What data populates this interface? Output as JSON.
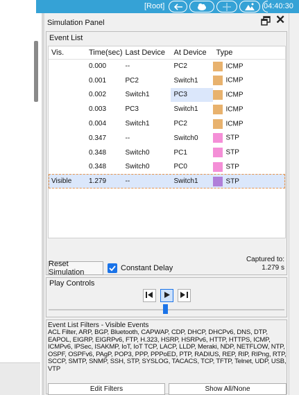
{
  "topbar": {
    "root_label": "[Root]",
    "time": "04:40:30"
  },
  "panel": {
    "title": "Simulation Panel",
    "event_list": {
      "title": "Event List",
      "columns": [
        "Vis.",
        "Time(sec)",
        "Last Device",
        "At Device",
        "Type"
      ],
      "rows": [
        {
          "vis": "",
          "time": "0.000",
          "last": "--",
          "at": "PC2",
          "type": "ICMP",
          "color": "#e8b26e"
        },
        {
          "vis": "",
          "time": "0.001",
          "last": "PC2",
          "at": "Switch1",
          "type": "ICMP",
          "color": "#e8b26e"
        },
        {
          "vis": "",
          "time": "0.002",
          "last": "Switch1",
          "at": "PC3",
          "type": "ICMP",
          "color": "#e8b26e"
        },
        {
          "vis": "",
          "time": "0.003",
          "last": "PC3",
          "at": "Switch1",
          "type": "ICMP",
          "color": "#e8b26e"
        },
        {
          "vis": "",
          "time": "0.004",
          "last": "Switch1",
          "at": "PC2",
          "type": "ICMP",
          "color": "#e8b26e"
        },
        {
          "vis": "",
          "time": "0.347",
          "last": "--",
          "at": "Switch0",
          "type": "STP",
          "color": "#f48fd7"
        },
        {
          "vis": "",
          "time": "0.348",
          "last": "Switch0",
          "at": "PC1",
          "type": "STP",
          "color": "#f48fd7"
        },
        {
          "vis": "",
          "time": "0.348",
          "last": "Switch0",
          "at": "PC0",
          "type": "STP",
          "color": "#f48fd7"
        },
        {
          "vis": "Visible",
          "time": "1.279",
          "last": "--",
          "at": "Switch1",
          "type": "STP",
          "color": "#b07fd9"
        }
      ],
      "reset_label": "Reset Simulation",
      "constant_delay_label": "Constant Delay",
      "captured_label": "Captured to:",
      "captured_value": "1.279 s"
    },
    "play_controls": {
      "title": "Play Controls"
    },
    "filters": {
      "title": "Event List Filters - Visible Events",
      "text": "ACL Filter, ARP, BGP, Bluetooth, CAPWAP, CDP, DHCP, DHCPv6, DNS, DTP, EAPOL, EIGRP, EIGRPv6, FTP, H.323, HSRP, HSRPv6, HTTP, HTTPS, ICMP, ICMPv6, IPSec, ISAKMP, IoT, IoT TCP, LACP, LLDP, Meraki, NDP, NETFLOW, NTP, OSPF, OSPFv6, PAgP, POP3, PPP, PPPoED, PTP, RADIUS, REP, RIP, RIPng, RTP, SCCP, SMTP, SNMP, SSH, STP, SYSLOG, TACACS, TCP, TFTP, Telnet, UDP, USB, VTP",
      "edit_label": "Edit Filters",
      "show_label": "Show All/None"
    }
  }
}
